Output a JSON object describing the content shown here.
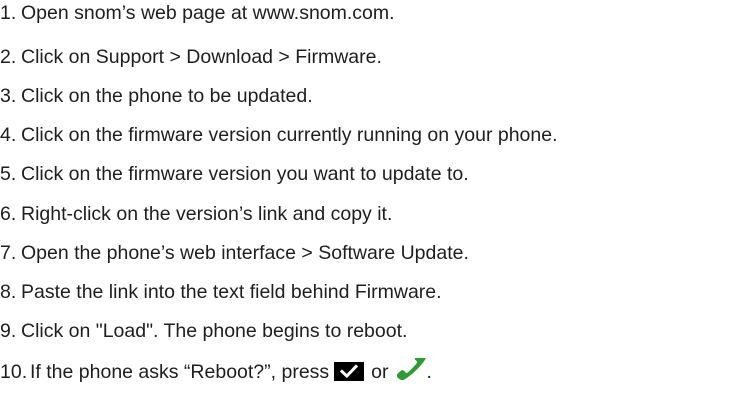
{
  "steps": [
    {
      "num": "1.",
      "text": "Open snom’s web page at www.snom.com."
    },
    {
      "num": "2.",
      "text": "Click on Support > Download > Firmware."
    },
    {
      "num": "3.",
      "text": "Click on the phone to be updated."
    },
    {
      "num": "4.",
      "text": "Click on the firmware version currently running on your phone."
    },
    {
      "num": "5.",
      "text": "Click on the firmware version you want to update to."
    },
    {
      "num": "6.",
      "text": "Right-click on the version’s link and copy it."
    },
    {
      "num": "7.",
      "text": "Open the phone’s web interface > Software Update."
    },
    {
      "num": "8.",
      "text": "Paste the link into the text field behind Firmware."
    },
    {
      "num": "9.",
      "text": "Click on \"Load\".  The phone begins to reboot."
    },
    {
      "num": "10.",
      "text_before": "If the phone asks “Reboot?”, press",
      "text_or": "or",
      "text_end": "."
    }
  ],
  "icons": {
    "check_key": "check-key-icon",
    "handset": "phone-handset-icon"
  },
  "colors": {
    "text": "#1e1e1e",
    "key_background": "#000000",
    "handset_green": "#2e9b35"
  }
}
